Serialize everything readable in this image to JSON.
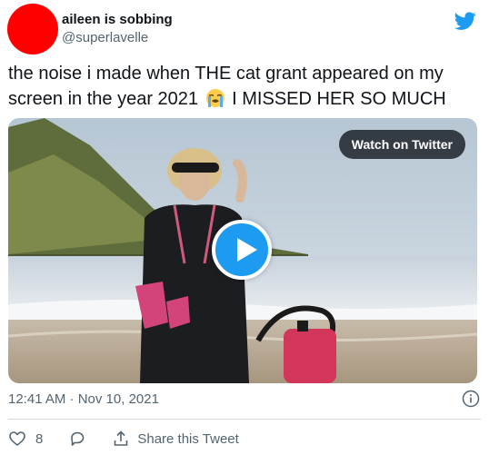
{
  "author": {
    "display_name": "aileen is sobbing",
    "handle": "@superlavelle",
    "avatar_color": "#ff0000"
  },
  "tweet": {
    "text_before_emoji": "the noise i made when THE cat grant appeared on my screen in the year 2021",
    "emoji": "loudly-crying-face",
    "text_after_emoji": "I MISSED HER SO MUCH"
  },
  "media": {
    "watch_label": "Watch on Twitter",
    "play_icon": "play-icon"
  },
  "meta": {
    "timestamp": "12:41 AM · Nov 10, 2021",
    "info_icon": "info-icon"
  },
  "actions": {
    "like_count": "8",
    "share_label": "Share this Tweet"
  },
  "colors": {
    "accent": "#1d9bf0",
    "text": "#0f1419",
    "secondary": "#536471",
    "divider": "#cfd9de"
  }
}
